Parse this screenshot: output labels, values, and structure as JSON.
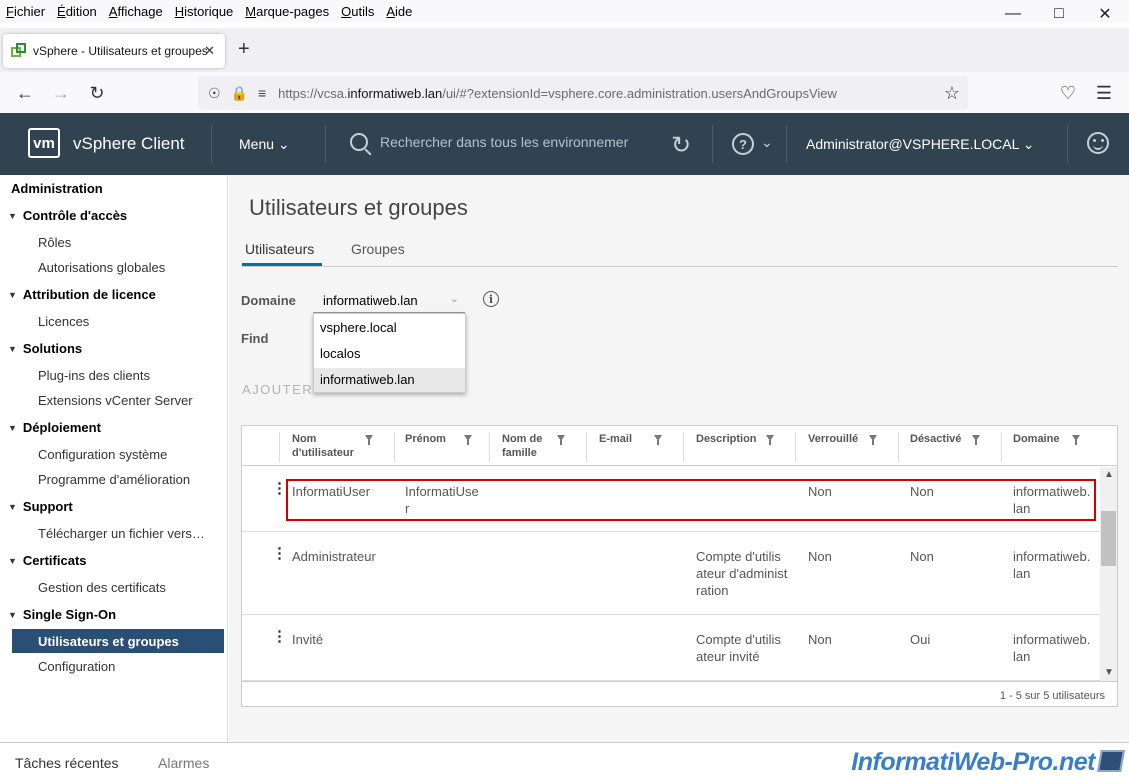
{
  "browser": {
    "menu": [
      {
        "u": "F",
        "rest": "ichier"
      },
      {
        "u": "É",
        "rest": "dition"
      },
      {
        "u": "A",
        "rest": "ffichage"
      },
      {
        "u": "H",
        "rest": "istorique"
      },
      {
        "u": "M",
        "rest": "arque-pages"
      },
      {
        "u": "O",
        "rest": "utils"
      },
      {
        "u": "A",
        "rest": "ide"
      }
    ],
    "tab_title": "vSphere - Utilisateurs et groupes",
    "url_prefix": "https://vcsa.",
    "url_domain": "informatiweb.lan",
    "url_rest": "/ui/#?extensionId=vsphere.core.administration.usersAndGroupsView"
  },
  "header": {
    "logo": "vm",
    "title": "vSphere Client",
    "menu": "Menu",
    "search_placeholder": "Rechercher dans tous les environnemer",
    "help": "?",
    "user": "Administrator@VSPHERE.LOCAL"
  },
  "sidebar": {
    "heading": "Administration",
    "groups": [
      {
        "label": "Contrôle d'accès",
        "items": [
          "Rôles",
          "Autorisations globales"
        ]
      },
      {
        "label": "Attribution de licence",
        "items": [
          "Licences"
        ]
      },
      {
        "label": "Solutions",
        "items": [
          "Plug-ins des clients",
          "Extensions vCenter Server"
        ]
      },
      {
        "label": "Déploiement",
        "items": [
          "Configuration système",
          "Programme d'amélioration"
        ]
      },
      {
        "label": "Support",
        "items": [
          "Télécharger un fichier vers le support"
        ]
      },
      {
        "label": "Certificats",
        "items": [
          "Gestion des certificats"
        ]
      },
      {
        "label": "Single Sign-On",
        "items": [
          "Utilisateurs et groupes",
          "Configuration"
        ]
      }
    ],
    "active_item": "Utilisateurs et groupes"
  },
  "main": {
    "title": "Utilisateurs et groupes",
    "tabs": [
      "Utilisateurs",
      "Groupes"
    ],
    "domain_label": "Domaine",
    "domain_value": "informatiweb.lan",
    "domain_options": [
      "vsphere.local",
      "localos",
      "informatiweb.lan"
    ],
    "find_label": "Find",
    "add_button": "AJOUTER",
    "columns": [
      "Nom d'utilisateur",
      "Prénom",
      "Nom de famille",
      "E-mail",
      "Description",
      "Verrouillé",
      "Désactivé",
      "Domaine"
    ],
    "rows": [
      {
        "username": "InformatiUser",
        "firstname": "InformatiUser",
        "lastname": "",
        "email": "",
        "description": "",
        "locked": "Non",
        "disabled": "Non",
        "domain": "informatiweb.lan"
      },
      {
        "username": "Administrateur",
        "firstname": "",
        "lastname": "",
        "email": "",
        "description": "Compte d'utilisateur d'administration",
        "locked": "Non",
        "disabled": "Non",
        "domain": "informatiweb.lan"
      },
      {
        "username": "Invité",
        "firstname": "",
        "lastname": "",
        "email": "",
        "description": "Compte d'utilisateur invité",
        "locked": "Non",
        "disabled": "Oui",
        "domain": "informatiweb.lan"
      }
    ],
    "footer": "1 - 5 sur 5 utilisateurs"
  },
  "bottom": {
    "recent_tasks": "Tâches récentes",
    "alarms": "Alarmes"
  },
  "watermark": "InformatiWeb-Pro.net",
  "colors": {
    "header_bg": "#314351",
    "active_nav": "#2b4f74",
    "tab_underline": "#0072a3",
    "highlight": "#d40000"
  }
}
